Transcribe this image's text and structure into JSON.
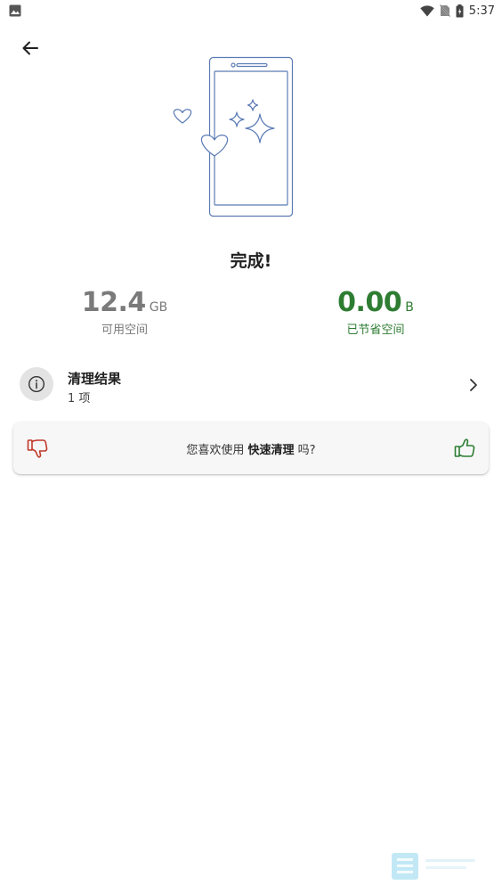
{
  "status_bar": {
    "time": "5:37",
    "icons": [
      "image-icon",
      "wifi-icon",
      "no-sim-icon",
      "battery-icon"
    ]
  },
  "header": {
    "back_icon": "arrow-left-icon"
  },
  "illustration": {
    "icon": "phone-sparkle-hearts-illustration",
    "stroke_color": "#5b7bb5"
  },
  "main": {
    "title": "完成!"
  },
  "stats": {
    "free": {
      "value": "12.4",
      "unit": "GB",
      "label": "可用空间",
      "color": "#7a7a7a"
    },
    "saved": {
      "value": "0.00",
      "unit": "B",
      "label": "已节省空间",
      "color": "#2e7d32"
    }
  },
  "result": {
    "icon": "info-icon",
    "title": "清理结果",
    "subtitle": "1 项",
    "chevron_icon": "chevron-right-icon"
  },
  "feedback": {
    "prefix": "您喜欢使用 ",
    "feature": "快速清理",
    "suffix": " 吗?",
    "thumb_down_icon": "thumb-down-icon",
    "thumb_down_color": "#c0392b",
    "thumb_up_icon": "thumb-up-icon",
    "thumb_up_color": "#2e7d32"
  }
}
